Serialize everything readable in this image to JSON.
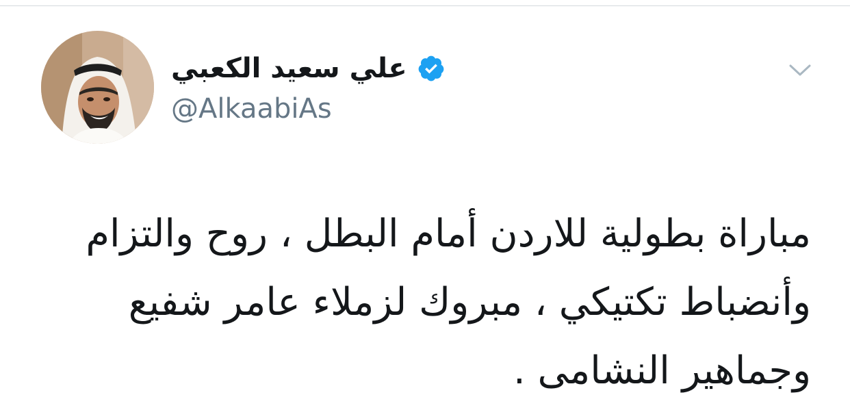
{
  "tweet": {
    "author": {
      "display_name": "علي سعيد الكعبي",
      "handle": "@AlkaabiAs",
      "verified": true,
      "avatar_icon": "profile-photo"
    },
    "menu_icon": "chevron-down-icon",
    "text": "مباراة بطولية للاردن أمام البطل ، روح والتزام\nوأنضباط تكتيكي ، مبروك لزملاء عامر شفيع\nوجماهير النشامى ."
  },
  "colors": {
    "verified_badge": "#1da1f2",
    "handle_text": "#657786",
    "body_text": "#14171a",
    "chevron": "#aab8c2"
  }
}
